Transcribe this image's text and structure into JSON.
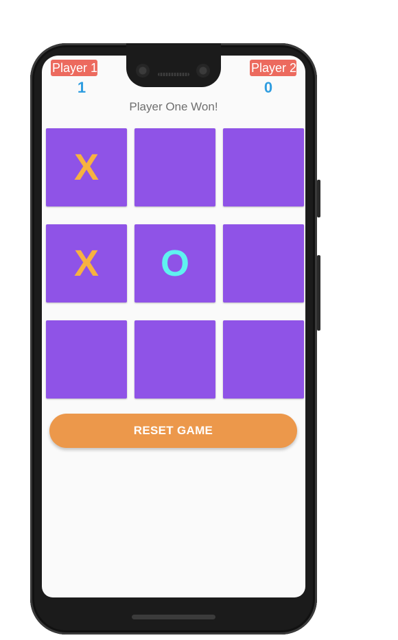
{
  "scoreboard": {
    "player1_label": "Player 1",
    "player1_score": "1",
    "player2_label": "Player 2",
    "player2_score": "0",
    "badge_color": "#ec6a5e",
    "score_color": "#2f9de0"
  },
  "status": {
    "message": "Player One Won!"
  },
  "board": {
    "cells": [
      "X",
      "",
      "",
      "X",
      "O",
      "",
      "",
      "",
      ""
    ],
    "cell_color": "#8f53e7",
    "x_color": "#f7b240",
    "o_color": "#5ff2f0"
  },
  "actions": {
    "reset_label": "RESET GAME",
    "reset_color": "#ec984b"
  }
}
